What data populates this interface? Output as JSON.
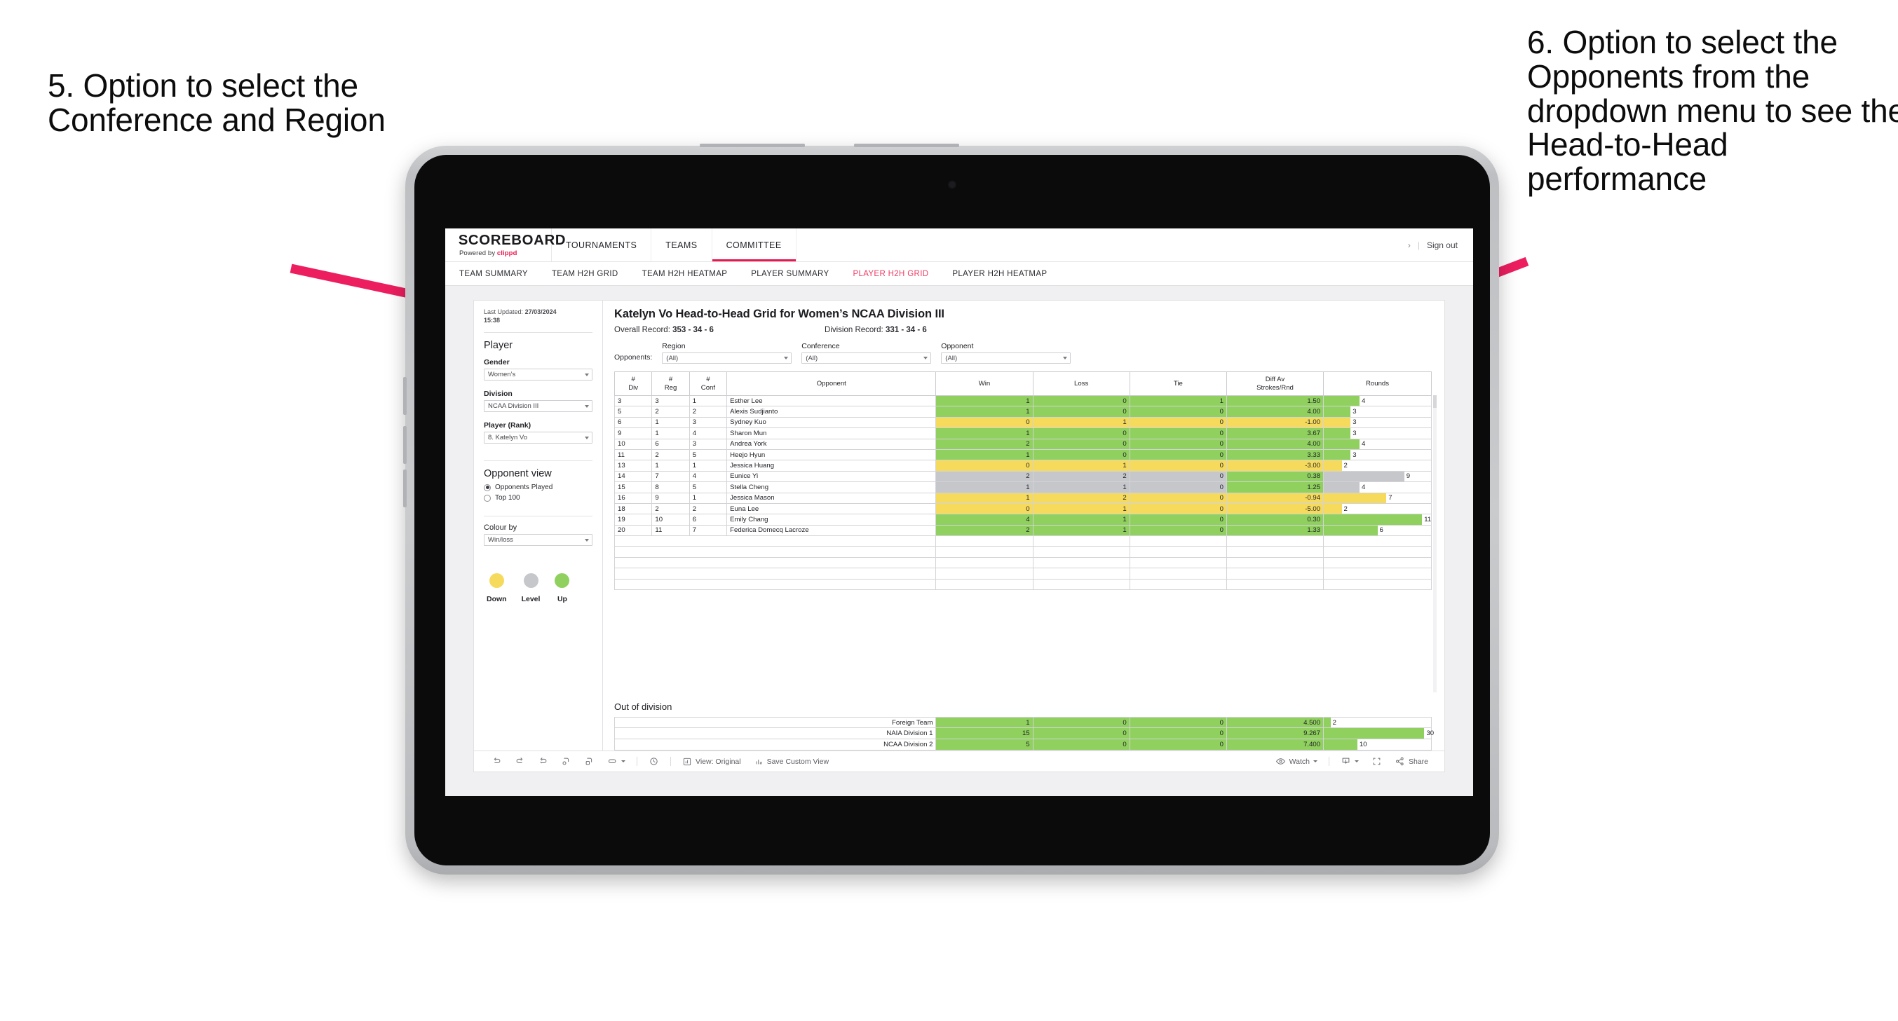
{
  "annotations": {
    "left": "5. Option to select the Conference and Region",
    "right": "6. Option to select the Opponents from the dropdown menu to see the Head-to-Head performance",
    "arrow_color": "#ed1e5f"
  },
  "app": {
    "brand": {
      "title": "SCOREBOARD",
      "powered_prefix": "Powered by",
      "powered_brand": "clippd"
    },
    "topnav": [
      {
        "label": "TOURNAMENTS",
        "active": false
      },
      {
        "label": "TEAMS",
        "active": false
      },
      {
        "label": "COMMITTEE",
        "active": true
      }
    ],
    "topbar_right": {
      "chevron": "›",
      "divider": "|",
      "sign_out": "Sign out"
    },
    "subnav": [
      {
        "label": "TEAM SUMMARY",
        "active": false
      },
      {
        "label": "TEAM H2H GRID",
        "active": false
      },
      {
        "label": "TEAM H2H HEATMAP",
        "active": false
      },
      {
        "label": "PLAYER SUMMARY",
        "active": false
      },
      {
        "label": "PLAYER H2H GRID",
        "active": true
      },
      {
        "label": "PLAYER H2H HEATMAP",
        "active": false
      }
    ],
    "accent": "#e8174e"
  },
  "sidebar": {
    "last_updated": {
      "prefix": "Last Updated:",
      "value": "27/03/2024",
      "time": "15:38"
    },
    "section_player": "Player",
    "fields": [
      {
        "label": "Gender",
        "value": "Women’s"
      },
      {
        "label": "Division",
        "value": "NCAA Division III"
      },
      {
        "label": "Player (Rank)",
        "value": "8. Katelyn Vo"
      }
    ],
    "opponent_view": {
      "title": "Opponent view",
      "options": [
        {
          "label": "Opponents Played",
          "selected": true
        },
        {
          "label": "Top 100",
          "selected": false
        }
      ]
    },
    "colour_by": {
      "label": "Colour by",
      "value": "Win/loss"
    },
    "legend": [
      {
        "label": "Down",
        "color": "#f5da5c"
      },
      {
        "label": "Level",
        "color": "#c6c7cb"
      },
      {
        "label": "Up",
        "color": "#8fd05e"
      }
    ]
  },
  "main": {
    "title": "Katelyn Vo Head-to-Head Grid for Women’s NCAA Division III",
    "overall_record_label": "Overall Record:",
    "overall_record": "353 - 34 - 6",
    "division_record_label": "Division Record:",
    "division_record": "331 - 34 - 6",
    "opponents_label": "Opponents:",
    "filters": [
      {
        "name": "Region",
        "value": "(All)"
      },
      {
        "name": "Conference",
        "value": "(All)"
      },
      {
        "name": "Opponent",
        "value": "(All)"
      }
    ],
    "out_of_division_title": "Out of division"
  },
  "chart_data": {
    "type": "table",
    "title": "Katelyn Vo Head-to-Head Grid for Women’s NCAA Division III",
    "columns": [
      "# Div",
      "# Reg",
      "# Conf",
      "Opponent",
      "Win",
      "Loss",
      "Tie",
      "Diff Av Strokes/Rnd",
      "Rounds"
    ],
    "column_header_lines": [
      [
        "#",
        "Div"
      ],
      [
        "#",
        "Reg"
      ],
      [
        "#",
        "Conf"
      ],
      [
        "Opponent"
      ],
      [
        "Win"
      ],
      [
        "Loss"
      ],
      [
        "Tie"
      ],
      [
        "Diff Av",
        "Strokes/Rnd"
      ],
      [
        "Rounds"
      ]
    ],
    "rounds_max": 12,
    "rows": [
      {
        "div": "3",
        "reg": "3",
        "conf": "1",
        "opponent": "Esther Lee",
        "win": "1",
        "loss": "0",
        "tie": "1",
        "diff": "1.50",
        "rounds": "4",
        "color": "#8fd05e"
      },
      {
        "div": "5",
        "reg": "2",
        "conf": "2",
        "opponent": "Alexis Sudjianto",
        "win": "1",
        "loss": "0",
        "tie": "0",
        "diff": "4.00",
        "rounds": "3",
        "color": "#8fd05e"
      },
      {
        "div": "6",
        "reg": "1",
        "conf": "3",
        "opponent": "Sydney Kuo",
        "win": "0",
        "loss": "1",
        "tie": "0",
        "diff": "-1.00",
        "rounds": "3",
        "color": "#f5da5c"
      },
      {
        "div": "9",
        "reg": "1",
        "conf": "4",
        "opponent": "Sharon Mun",
        "win": "1",
        "loss": "0",
        "tie": "0",
        "diff": "3.67",
        "rounds": "3",
        "color": "#8fd05e"
      },
      {
        "div": "10",
        "reg": "6",
        "conf": "3",
        "opponent": "Andrea York",
        "win": "2",
        "loss": "0",
        "tie": "0",
        "diff": "4.00",
        "rounds": "4",
        "color": "#8fd05e"
      },
      {
        "div": "11",
        "reg": "2",
        "conf": "5",
        "opponent": "Heejo Hyun",
        "win": "1",
        "loss": "0",
        "tie": "0",
        "diff": "3.33",
        "rounds": "3",
        "color": "#8fd05e"
      },
      {
        "div": "13",
        "reg": "1",
        "conf": "1",
        "opponent": "Jessica Huang",
        "win": "0",
        "loss": "1",
        "tie": "0",
        "diff": "-3.00",
        "rounds": "2",
        "color": "#f5da5c"
      },
      {
        "div": "14",
        "reg": "7",
        "conf": "4",
        "opponent": "Eunice Yi",
        "win": "2",
        "loss": "2",
        "tie": "0",
        "diff": "0.38",
        "rounds": "9",
        "color": "#c6c7cb",
        "diff_color": "#8fd05e"
      },
      {
        "div": "15",
        "reg": "8",
        "conf": "5",
        "opponent": "Stella Cheng",
        "win": "1",
        "loss": "1",
        "tie": "0",
        "diff": "1.25",
        "rounds": "4",
        "color": "#c6c7cb",
        "diff_color": "#8fd05e"
      },
      {
        "div": "16",
        "reg": "9",
        "conf": "1",
        "opponent": "Jessica Mason",
        "win": "1",
        "loss": "2",
        "tie": "0",
        "diff": "-0.94",
        "rounds": "7",
        "color": "#f5da5c"
      },
      {
        "div": "18",
        "reg": "2",
        "conf": "2",
        "opponent": "Euna Lee",
        "win": "0",
        "loss": "1",
        "tie": "0",
        "diff": "-5.00",
        "rounds": "2",
        "color": "#f5da5c"
      },
      {
        "div": "19",
        "reg": "10",
        "conf": "6",
        "opponent": "Emily Chang",
        "win": "4",
        "loss": "1",
        "tie": "0",
        "diff": "0.30",
        "rounds": "11",
        "color": "#8fd05e"
      },
      {
        "div": "20",
        "reg": "11",
        "conf": "7",
        "opponent": "Federica Domecq Lacroze",
        "win": "2",
        "loss": "1",
        "tie": "0",
        "diff": "1.33",
        "rounds": "6",
        "color": "#8fd05e"
      }
    ],
    "out_of_division": {
      "rounds_max": 32,
      "rows": [
        {
          "name": "Foreign Team",
          "win": "1",
          "loss": "0",
          "tie": "0",
          "diff": "4.500",
          "rounds": "2",
          "color": "#8fd05e"
        },
        {
          "name": "NAIA Division 1",
          "win": "15",
          "loss": "0",
          "tie": "0",
          "diff": "9.267",
          "rounds": "30",
          "color": "#8fd05e"
        },
        {
          "name": "NCAA Division 2",
          "win": "5",
          "loss": "0",
          "tie": "0",
          "diff": "7.400",
          "rounds": "10",
          "color": "#8fd05e"
        }
      ]
    }
  },
  "toolbar": {
    "undo": "undo-icon",
    "redo": "redo-icon",
    "revert": "revert-icon",
    "refresh": "refresh-icon",
    "pause": "pause-icon",
    "view_original_label": "View: Original",
    "save_custom_view_label": "Save Custom View",
    "watch_label": "Watch",
    "share_label": "Share"
  }
}
